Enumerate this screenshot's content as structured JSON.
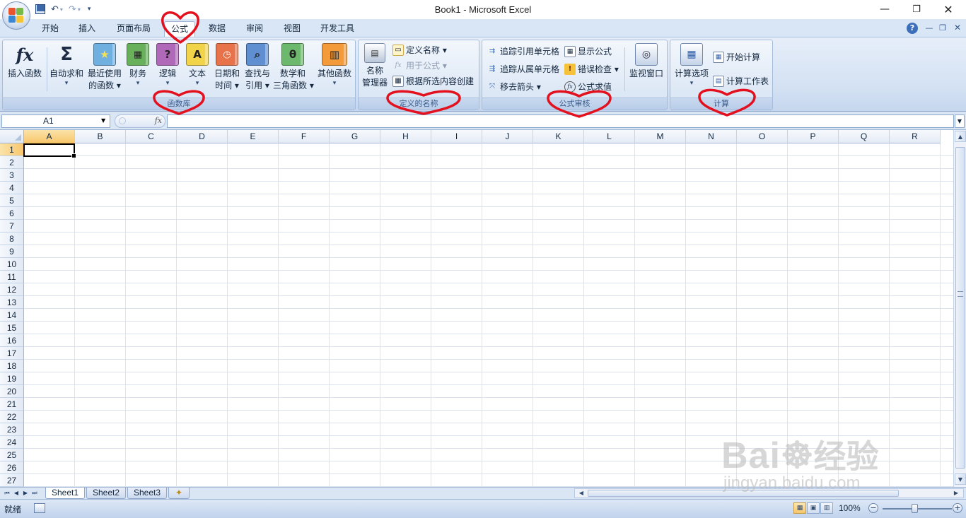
{
  "window": {
    "title": "Book1 - Microsoft Excel",
    "controls": [
      "minimize",
      "restore",
      "close"
    ]
  },
  "quick_access": {
    "icons": [
      "save-icon",
      "undo-icon",
      "redo-icon",
      "customize-qat-icon"
    ]
  },
  "tabs": [
    {
      "label": "开始"
    },
    {
      "label": "插入"
    },
    {
      "label": "页面布局"
    },
    {
      "label": "公式",
      "active": true
    },
    {
      "label": "数据"
    },
    {
      "label": "审阅"
    },
    {
      "label": "视图"
    },
    {
      "label": "开发工具"
    }
  ],
  "ribbon": {
    "function_library": {
      "label": "函数库",
      "insert_function": "插入函数",
      "buttons": [
        {
          "line1": "自动求和",
          "line2": "▾",
          "icon": "sigma-icon"
        },
        {
          "line1": "最近使用",
          "line2": "的函数 ▾",
          "icon": "recent-book-icon",
          "color": "#6fb0e0"
        },
        {
          "line1": "财务",
          "line2": "▾",
          "icon": "finance-book-icon",
          "color": "#68b05a"
        },
        {
          "line1": "逻辑",
          "line2": "▾",
          "icon": "logic-book-icon",
          "color": "#b068b8"
        },
        {
          "line1": "文本",
          "line2": "▾",
          "icon": "text-book-icon",
          "color": "#f2d44a"
        },
        {
          "line1": "日期和",
          "line2": "时间 ▾",
          "icon": "datetime-book-icon",
          "color": "#e8734a"
        },
        {
          "line1": "查找与",
          "line2": "引用 ▾",
          "icon": "lookup-book-icon",
          "color": "#5f8fd0"
        },
        {
          "line1": "数学和",
          "line2": "三角函数 ▾",
          "icon": "math-book-icon",
          "color": "#6cb86c"
        },
        {
          "line1": "其他函数",
          "line2": "▾",
          "icon": "more-books-icon",
          "color": "#f39a3a"
        }
      ]
    },
    "defined_names": {
      "label": "定义的名称",
      "name_manager_line1": "名称",
      "name_manager_line2": "管理器",
      "define_name": "定义名称 ▾",
      "use_in_formula": "用于公式 ▾",
      "create_from_selection": "根据所选内容创建"
    },
    "formula_auditing": {
      "label": "公式审核",
      "trace_precedents": "追踪引用单元格",
      "trace_dependents": "追踪从属单元格",
      "remove_arrows": "移去箭头 ▾",
      "show_formulas": "显示公式",
      "error_checking": "错误检查 ▾",
      "evaluate_formula": "公式求值",
      "watch_window": "监视窗口"
    },
    "calculation": {
      "label": "计算",
      "calc_options": "计算选项",
      "calc_options_drop": "▾",
      "calc_now": "开始计算",
      "calc_sheet": "计算工作表"
    }
  },
  "formula_bar": {
    "name_box": "A1",
    "fx": "fx",
    "value": ""
  },
  "grid": {
    "columns": [
      "A",
      "B",
      "C",
      "D",
      "E",
      "F",
      "G",
      "H",
      "I",
      "J",
      "K",
      "L",
      "M",
      "N",
      "O",
      "P",
      "Q",
      "R"
    ],
    "rows": [
      "1",
      "2",
      "3",
      "4",
      "5",
      "6",
      "7",
      "8",
      "9",
      "10",
      "11",
      "12",
      "13",
      "14",
      "15",
      "16",
      "17",
      "18",
      "19",
      "20",
      "21",
      "22",
      "23",
      "24",
      "25",
      "26",
      "27"
    ],
    "active_cell": "A1"
  },
  "sheets": [
    {
      "name": "Sheet1",
      "active": true
    },
    {
      "name": "Sheet2"
    },
    {
      "name": "Sheet3"
    }
  ],
  "status": {
    "ready": "就绪",
    "zoom": "100%"
  },
  "watermark": {
    "brand": "Bai",
    "brand2": "经验",
    "url": "jingyan.baidu.com"
  },
  "colors": {
    "accent": "#c5d7ef",
    "annotation": "#e3101e",
    "selected_header": "#f7c76c"
  }
}
